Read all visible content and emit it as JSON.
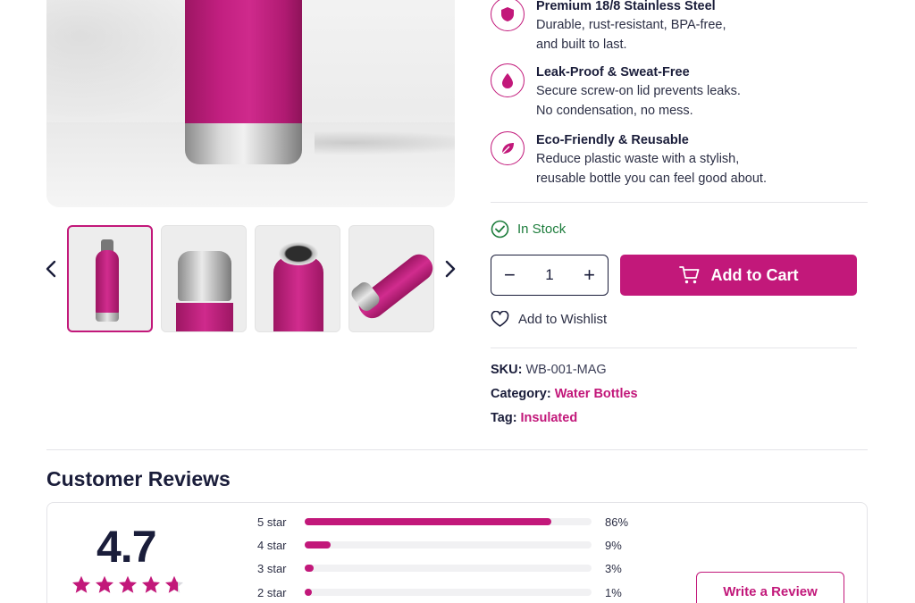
{
  "features": [
    {
      "title": "Premium 18/8 Stainless Steel",
      "line1": "Durable, rust-resistant, BPA-free,",
      "line2": "and built to last.",
      "icon": "shield-icon"
    },
    {
      "title": "Leak-Proof & Sweat-Free",
      "line1": "Secure screw-on lid prevents leaks.",
      "line2": "No condensation, no mess.",
      "icon": "droplet-icon"
    },
    {
      "title": "Eco-Friendly & Reusable",
      "line1": "Reduce plastic waste with a stylish,",
      "line2": "reusable bottle you can feel good about.",
      "icon": "leaf-icon"
    }
  ],
  "stock": {
    "label": "In Stock",
    "color": "#1d7d3c"
  },
  "quantity": {
    "value": "1",
    "minus": "−",
    "plus": "+"
  },
  "cart": {
    "label": "Add to Cart",
    "color": "#c2187a"
  },
  "wishlist": {
    "label": "Add to Wishlist"
  },
  "meta": {
    "sku_key": "SKU:",
    "sku_value": "WB-001-MAG",
    "category_key": "Category:",
    "category_value": "Water Bottles",
    "tag_key": "Tag:",
    "tag_value": "Insulated"
  },
  "reviews": {
    "title": "Customer Reviews",
    "average": "4.7",
    "average_value": 4.7,
    "max_stars": 5,
    "breakdown": [
      {
        "label": "5 star",
        "percent_label": "86%",
        "percent": 86
      },
      {
        "label": "4 star",
        "percent_label": "9%",
        "percent": 9
      },
      {
        "label": "3 star",
        "percent_label": "3%",
        "percent": 3
      },
      {
        "label": "2 star",
        "percent_label": "1%",
        "percent": 1
      }
    ],
    "write_button": "Write a Review"
  },
  "gallery": {
    "thumbnails": 4,
    "active_index": 0
  }
}
